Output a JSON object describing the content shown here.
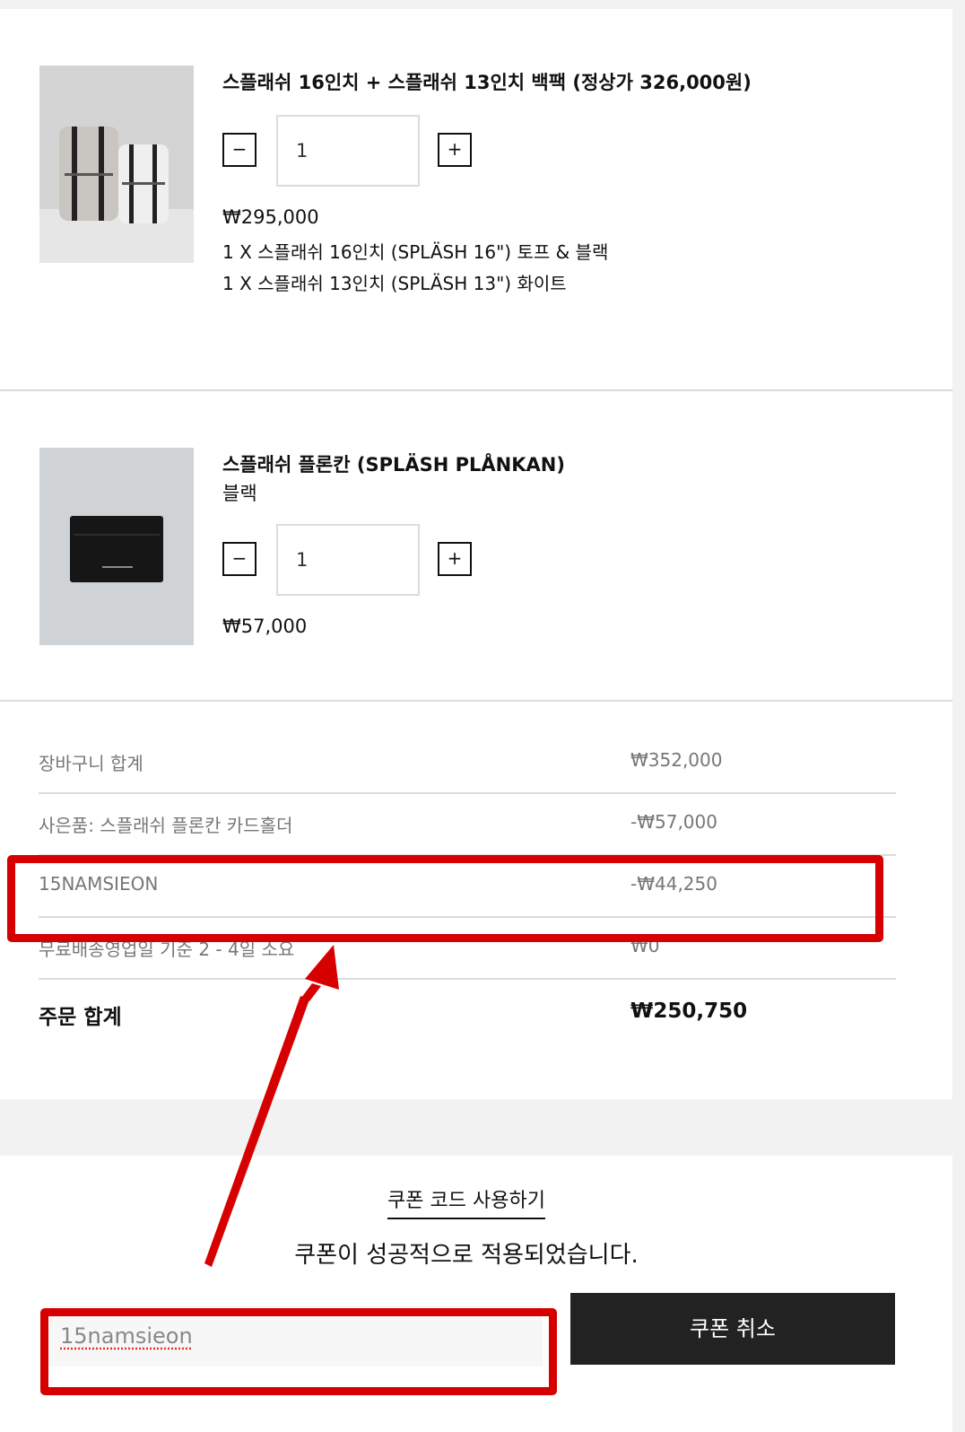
{
  "items": [
    {
      "title": "스플래쉬 16인치 + 스플래쉬 13인치 백팩 (정상가 326,000원)",
      "quantity": "1",
      "minus": "−",
      "plus": "+",
      "price": "₩295,000",
      "details": [
        "1 X 스플래쉬 16인치 (SPLÄSH 16\") 토프 & 블랙",
        "1 X 스플래쉬 13인치 (SPLÄSH 13\") 화이트"
      ]
    },
    {
      "title": "스플래쉬 플론칸 (SPLÄSH PLÅNKAN)",
      "variant": "블랙",
      "quantity": "1",
      "minus": "−",
      "plus": "+",
      "price": "₩57,000"
    }
  ],
  "summary": {
    "subtotal": {
      "label": "장바구니 합계",
      "value": "₩352,000"
    },
    "gift": {
      "label": "사은품: 스플래쉬 플론칸 카드홀더",
      "value": "-₩57,000"
    },
    "coupon": {
      "label": "15NAMSIEON",
      "value": "-₩44,250"
    },
    "shipping": {
      "label": "무료배송영업일 기준 2 - 4일 소요",
      "value": "₩0"
    },
    "total": {
      "label": "주문 합계",
      "value": "₩250,750"
    }
  },
  "coupon": {
    "link_label": "쿠폰 코드 사용하기",
    "success_message": "쿠폰이 성공적으로 적용되었습니다.",
    "input_value": "15namsieon",
    "cancel_label": "쿠폰 취소"
  },
  "colors": {
    "annotation": "#d60000",
    "button_dark": "#222222",
    "divider": "#dcdcdc"
  }
}
